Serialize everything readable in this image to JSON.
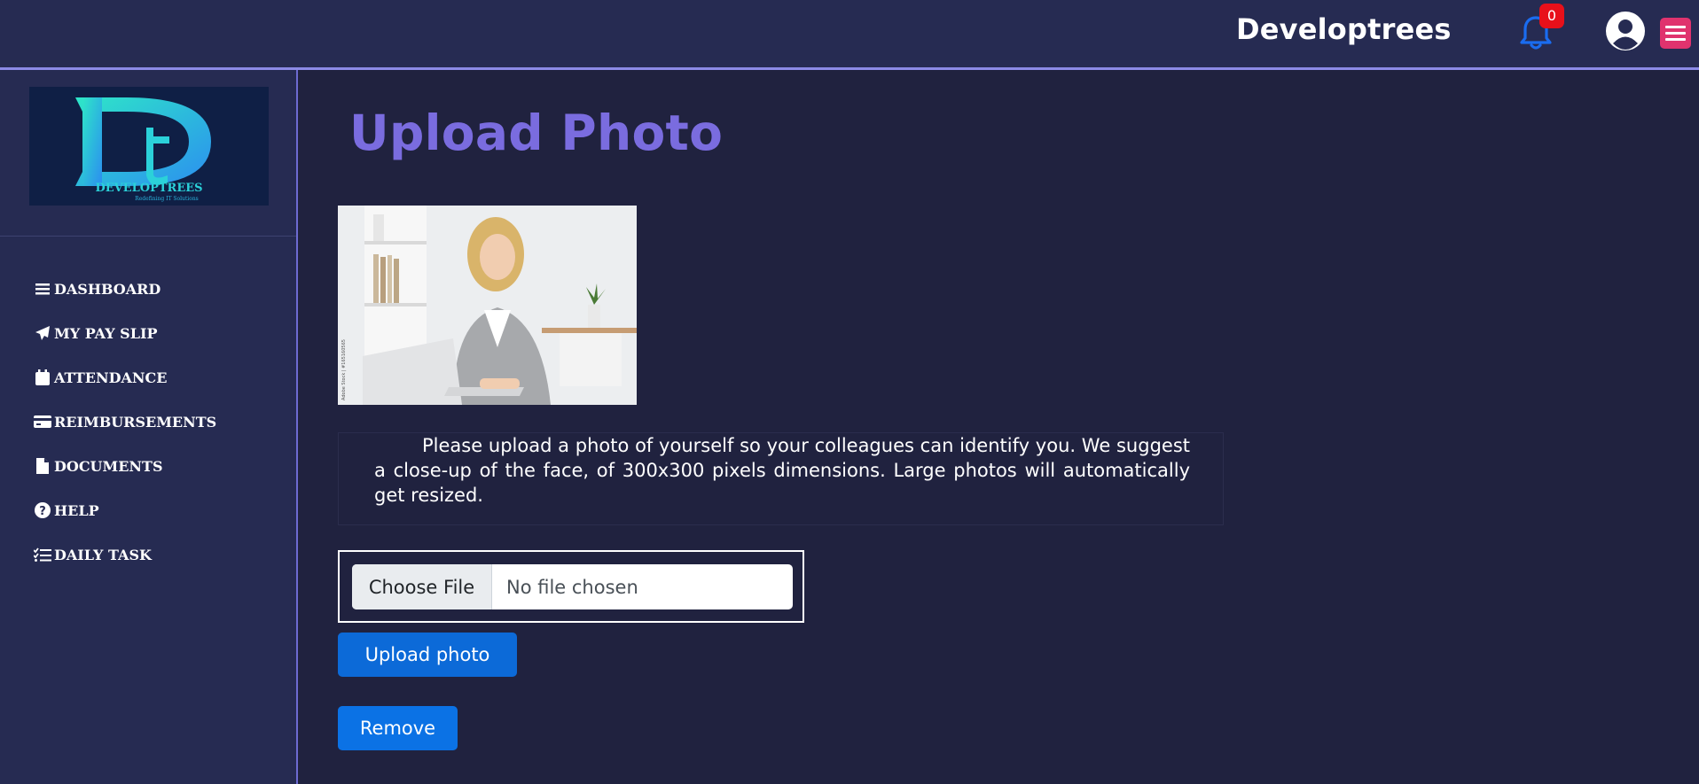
{
  "header": {
    "brand": "Developtrees",
    "notification_count": "0",
    "icons": [
      "bell-icon",
      "user-circle-icon",
      "menu-icon"
    ],
    "accent_color": "#e0336e"
  },
  "sidebar": {
    "logo_text": "DEVELOPTREES",
    "items": [
      {
        "label": "DASHBOARD",
        "icon": "bars-icon"
      },
      {
        "label": "MY PAY SLIP",
        "icon": "paper-plane-icon"
      },
      {
        "label": "ATTENDANCE",
        "icon": "calendar-icon"
      },
      {
        "label": "REIMBURSEMENTS",
        "icon": "credit-card-icon"
      },
      {
        "label": "DOCUMENTS",
        "icon": "file-icon"
      },
      {
        "label": "HELP",
        "icon": "question-circle-icon"
      },
      {
        "label": "DAILY TASK",
        "icon": "tasks-icon"
      }
    ]
  },
  "main": {
    "title": "Upload Photo",
    "photo_caption": "Adobe Stock | #165160565",
    "instructions": "Please upload a photo of yourself so your colleagues can identify you. We suggest a close-up of the face, of 300x300 pixels dimensions. Large photos will automatically get resized.",
    "file_input": {
      "button_label": "Choose File",
      "status": "No file chosen"
    },
    "upload_button": "Upload photo",
    "remove_button": "Remove",
    "title_color": "#7a6cdf",
    "button_color": "#0c6ad8"
  }
}
